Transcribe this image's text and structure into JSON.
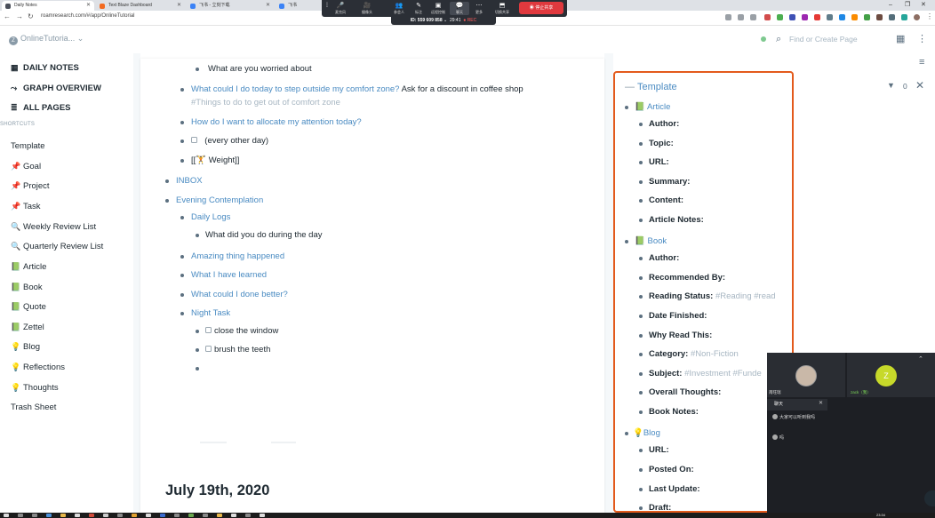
{
  "browser": {
    "tabs": [
      {
        "label": "Daily Notes",
        "color": "#4a4f5a",
        "active": true
      },
      {
        "label": "Text Blaze Dashboard",
        "color": "#f36b21",
        "active": false
      },
      {
        "label": "飞书 - 立刻下载",
        "color": "#3b82f6",
        "active": false
      },
      {
        "label": "飞书",
        "color": "#3b82f6",
        "active": false
      }
    ],
    "url": "roamresearch.com/#/app/OnlineTutorial",
    "window_controls": {
      "minimize": "–",
      "restore": "❐",
      "close": "✕"
    }
  },
  "meeting": {
    "items": [
      {
        "icon": "🎤",
        "label": "麦克风"
      },
      {
        "icon": "🎥",
        "label": "摄像头"
      },
      {
        "icon": "👥",
        "label": "参会人"
      },
      {
        "icon": "✎",
        "label": "标注"
      },
      {
        "icon": "▣",
        "label": "远程控制"
      },
      {
        "icon": "💬",
        "label": "聊天"
      },
      {
        "icon": "⋯",
        "label": "更多"
      },
      {
        "icon": "⬒",
        "label": "切换共享"
      }
    ],
    "stop_label": "停止共享",
    "meeting_id": "ID: 559 609 858",
    "elapsed": "29:41",
    "rec": "● REC"
  },
  "roam": {
    "graph_name": "OnlineTutoria...",
    "graph_initial": "Z",
    "search_placeholder": "Find or Create Page"
  },
  "leftnav": {
    "main": [
      {
        "icon": "▦",
        "label": "DAILY NOTES"
      },
      {
        "icon": "⤳",
        "label": "GRAPH OVERVIEW"
      },
      {
        "icon": "≣",
        "label": "ALL PAGES"
      }
    ],
    "shortcuts_label": "SHORTCUTS",
    "shortcuts": [
      {
        "icon": "",
        "label": "Template"
      },
      {
        "icon": "📌",
        "label": "Goal"
      },
      {
        "icon": "📌",
        "label": "Project"
      },
      {
        "icon": "📌",
        "label": "Task"
      },
      {
        "icon": "🔍",
        "label": "Weekly Review List"
      },
      {
        "icon": "🔍",
        "label": "Quarterly Review List"
      },
      {
        "icon": "📗",
        "label": "Article"
      },
      {
        "icon": "📗",
        "label": "Book"
      },
      {
        "icon": "📗",
        "label": "Quote"
      },
      {
        "icon": "📗",
        "label": "Zettel"
      },
      {
        "icon": "💡",
        "label": "Blog"
      },
      {
        "icon": "💡",
        "label": "Reflections"
      },
      {
        "icon": "💡",
        "label": "Thoughts"
      },
      {
        "icon": "",
        "label": "Trash Sheet"
      }
    ]
  },
  "main": {
    "blocks": {
      "worried": "What are you worried about",
      "comfort_link": "What could I do today to step outside my comfort zone?",
      "comfort_answer": " Ask for a discount in coffee shop",
      "comfort_tag": "#Things to do to get out of comfort zone",
      "attention": "How do I want to allocate my attention today?",
      "every_other_day": "(every other day)",
      "weight_open": "[[",
      "weight_icon": "🏋",
      "weight_label": " Weight]]",
      "inbox": "INBOX",
      "evening": "Evening Contemplation",
      "daily_logs": "Daily Logs",
      "what_did": "What did you do during the day",
      "amazing": "Amazing thing happened",
      "learned": "What I have learned",
      "better": "What could I done better?",
      "night_task": "Night Task",
      "close_window": "close the window",
      "brush_teeth": "brush the teeth"
    },
    "date_title": "July 19th, 2020"
  },
  "right_sidebar": {
    "title": "Template",
    "filter_count": "0",
    "article": {
      "label": "Article",
      "fields": [
        "Author:",
        "Topic:",
        "URL:",
        "Summary:",
        "Content:",
        "Article Notes:"
      ]
    },
    "book": {
      "label": "Book",
      "author": "Author:",
      "recommended": "Recommended By:",
      "reading_status": "Reading Status:",
      "reading_tags": "#Reading #read",
      "date_finished": "Date Finished:",
      "why_read": "Why Read This:",
      "category": "Category:",
      "category_tag": "#Non-Fiction",
      "subject": "Subject:",
      "subject_tags": "#Investment #Funde",
      "overall": "Overall Thoughts:",
      "notes": "Book Notes:"
    },
    "blog": {
      "label": "Blog",
      "fields": [
        "URL:",
        "Posted On:",
        "Last Update:",
        "Draft:"
      ]
    }
  },
  "call": {
    "participant1": "南旺瑞",
    "participant2": "zack（我）",
    "participant2_initial": "Z",
    "chat_title": "聊天",
    "messages": [
      "大家可以听到我吗",
      "吗"
    ]
  },
  "taskbar": {
    "clock": "23:34"
  },
  "colors": {
    "link": "#4a8bc2",
    "highlight_border": "#e35a1c",
    "stop_button": "#e0393e"
  }
}
